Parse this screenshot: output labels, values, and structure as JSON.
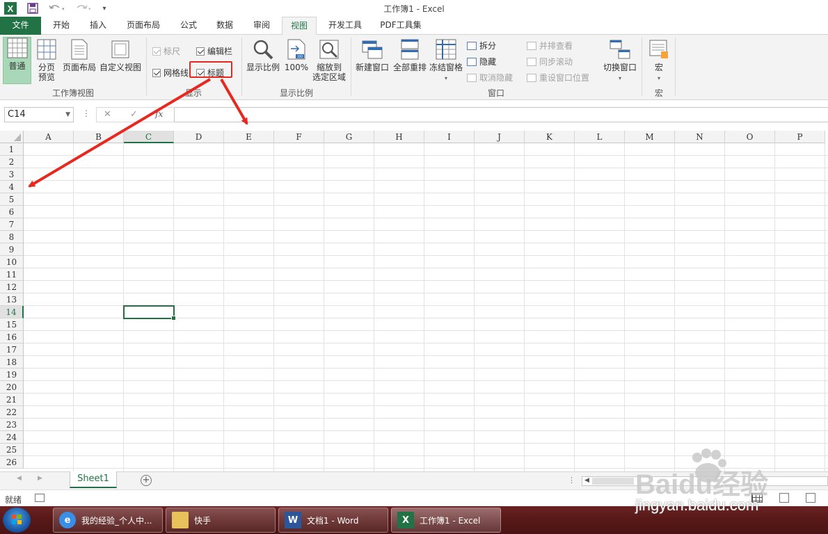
{
  "window": {
    "title": "工作簿1 - Excel"
  },
  "quick_access": {
    "undo_icon": "undo-icon",
    "redo_icon": "redo-icon",
    "save_icon": "save-icon"
  },
  "tabs": [
    "文件",
    "开始",
    "插入",
    "页面布局",
    "公式",
    "数据",
    "审阅",
    "视图",
    "开发工具",
    "PDF工具集"
  ],
  "active_tab": "视图",
  "ribbon": {
    "workbook_views": {
      "group_label": "工作簿视图",
      "normal": "普通",
      "page_break_1": "分页",
      "page_break_2": "预览",
      "page_layout": "页面布局",
      "custom_views": "自定义视图"
    },
    "show": {
      "group_label": "显示",
      "ruler": "标尺",
      "formula_bar": "编辑栏",
      "gridlines": "网格线",
      "headings": "标题",
      "ruler_checked": true,
      "formula_bar_checked": true,
      "gridlines_checked": true,
      "headings_checked": true
    },
    "zoom": {
      "group_label": "显示比例",
      "zoom": "显示比例",
      "hundred": "100%",
      "zoom_sel_1": "缩放到",
      "zoom_sel_2": "选定区域"
    },
    "window": {
      "group_label": "窗口",
      "new_window": "新建窗口",
      "arrange_all": "全部重排",
      "freeze_panes": "冻结窗格",
      "split": "拆分",
      "hide": "隐藏",
      "unhide": "取消隐藏",
      "side_by_side": "并排查看",
      "sync_scroll": "同步滚动",
      "reset_position": "重设窗口位置",
      "switch_windows": "切换窗口"
    },
    "macros": {
      "group_label": "宏",
      "macros": "宏"
    }
  },
  "formula_bar": {
    "name_box": "C14",
    "cancel": "✕",
    "enter": "✓",
    "fx": "fx",
    "value": ""
  },
  "columns": [
    "A",
    "B",
    "C",
    "D",
    "E",
    "F",
    "G",
    "H",
    "I",
    "J",
    "K",
    "L",
    "M",
    "N",
    "O",
    "P"
  ],
  "rows": [
    "1",
    "2",
    "3",
    "4",
    "5",
    "6",
    "7",
    "8",
    "9",
    "10",
    "11",
    "12",
    "13",
    "14",
    "15",
    "16",
    "17",
    "18",
    "19",
    "20",
    "21",
    "22",
    "23",
    "24",
    "25",
    "26"
  ],
  "active_cell": {
    "column": "C",
    "row": "14"
  },
  "sheet_tabs": {
    "active": "Sheet1",
    "add_icon": "plus-circle-icon"
  },
  "status": {
    "ready": "就绪"
  },
  "taskbar": {
    "items": [
      {
        "label": "我的经验_个人中...",
        "icon": "browser-icon"
      },
      {
        "label": "快手",
        "icon": "folder-icon"
      },
      {
        "label": "文档1 - Word",
        "icon": "word-icon"
      },
      {
        "label": "工作簿1 - Excel",
        "icon": "excel-icon"
      }
    ]
  },
  "watermark": {
    "brand": "Baidu经验",
    "url": "jingyan.baidu.com"
  },
  "colors": {
    "excel_green": "#217346",
    "highlight_red": "#e8281e",
    "taskbar": "#5a1919"
  }
}
